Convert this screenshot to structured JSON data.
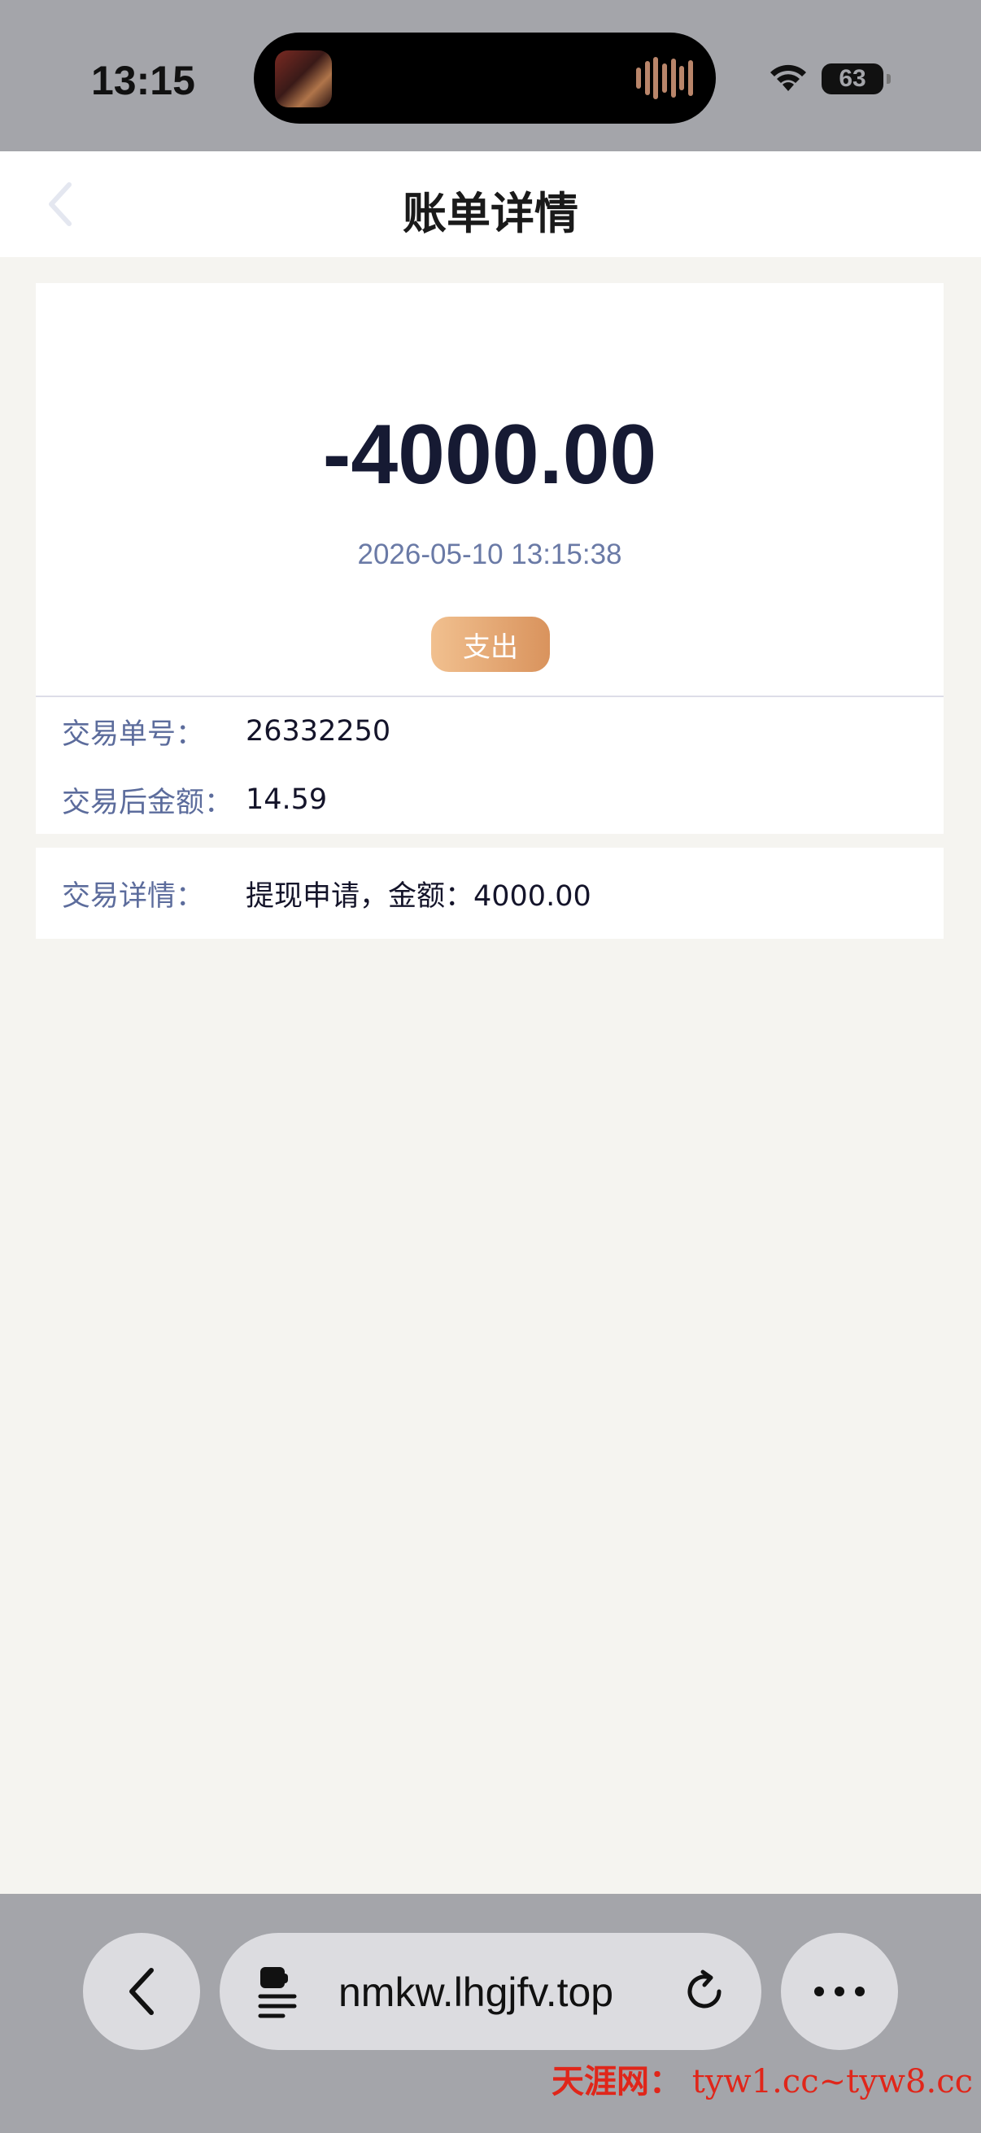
{
  "status_bar": {
    "time": "13:15",
    "battery": "63"
  },
  "nav": {
    "title": "账单详情"
  },
  "summary": {
    "amount": "-4000.00",
    "datetime": "2026-05-10 13:15:38",
    "type_badge": "支出"
  },
  "info": {
    "rows": [
      {
        "label": "交易单号：",
        "value": "26332250"
      },
      {
        "label": "交易后金额：",
        "value": "14.59"
      }
    ],
    "detail": {
      "label": "交易详情：",
      "value": "提现申请，金额：4000.00"
    }
  },
  "browser": {
    "url": "nmkw.lhgjfv.top"
  },
  "watermark": {
    "site": "天涯网：",
    "urls": "tyw1.cc~tyw8.cc"
  },
  "colors": {
    "accent_badge_start": "#f1c08f",
    "accent_badge_end": "#d9935d",
    "label_color": "#5c6c9c",
    "amount_color": "#161a33"
  },
  "icons": {
    "nav_back": "chevron-left-icon",
    "wifi": "wifi-icon",
    "battery": "battery-icon",
    "browser_back": "chevron-left-icon",
    "page": "page-icon",
    "reload": "reload-icon",
    "more": "ellipsis-icon"
  }
}
